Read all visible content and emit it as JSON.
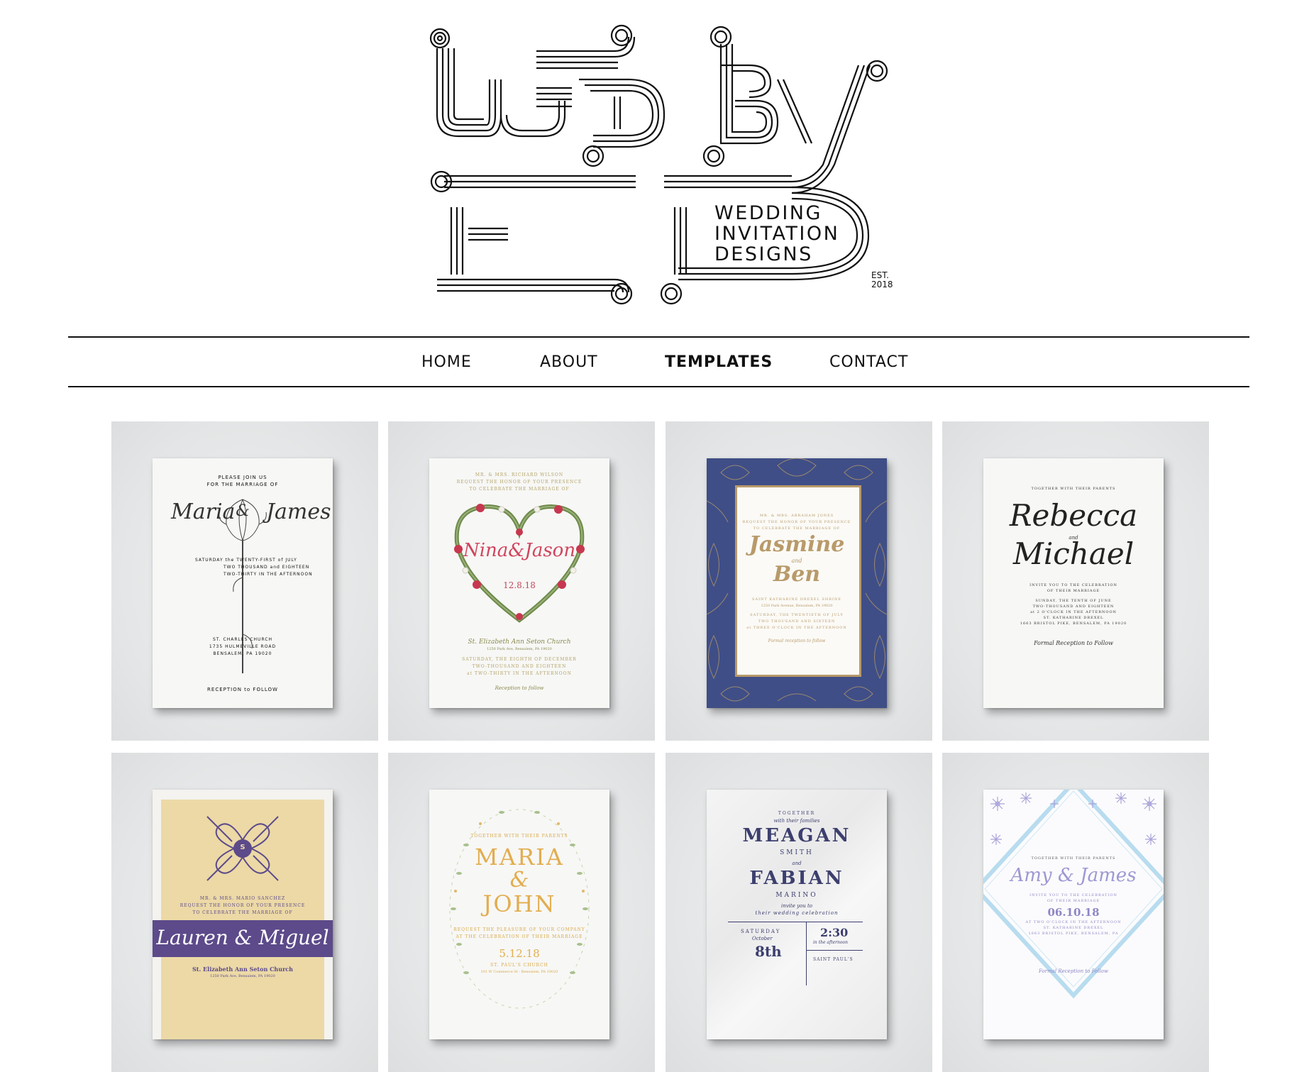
{
  "logo": {
    "sub_lines": [
      "WEDDING",
      "INVITATION",
      "DESIGNS"
    ],
    "est": [
      "EST.",
      "2018"
    ]
  },
  "nav": {
    "items": [
      {
        "label": "HOME"
      },
      {
        "label": "ABOUT"
      },
      {
        "label": "TEMPLATES",
        "active": true
      },
      {
        "label": "CONTACT"
      }
    ]
  },
  "templates": {
    "maria_james": {
      "top": "PLEASE JOIN US",
      "top2": "FOR THE MARRIAGE OF",
      "name1": "Maria",
      "amp": "&",
      "name2": "James",
      "date1": "SATURDAY the TWENTY-FIRST of JULY",
      "date2": "TWO THOUSAND and EIGHTEEN",
      "date3": "TWO-THIRTY IN THE AFTERNOON",
      "venue1": "ST. CHARLES CHURCH",
      "venue2": "1735 HULMEVILLE ROAD",
      "venue3": "BENSALEM, PA 19020",
      "reception": "RECEPTION to FOLLOW"
    },
    "nina_jason": {
      "top1": "MR. & MRS. RICHARD WILSON",
      "top2": "REQUEST THE HONOR OF YOUR PRESENCE",
      "top3": "TO CELEBRATE THE MARRIAGE OF",
      "names": "Nina&Jason",
      "date": "12.8.18",
      "venue": "St. Elizabeth Ann Seton Church",
      "address": "1250 Park Ave, Bensalem, PA 19020",
      "line1": "SATURDAY, THE EIGHTH OF DECEMBER",
      "line2": "TWO-THOUSAND AND EIGHTEEN",
      "line3": "at TWO-THIRTY IN THE AFTERNOON",
      "reception": "Reception to follow"
    },
    "jasmine_ben": {
      "top1": "MR. & MRS. ABRAHAM JONES",
      "top2": "REQUEST THE HONOR OF YOUR PRESENCE",
      "top3": "TO CELEBRATE THE MARRIAGE OF",
      "name1": "Jasmine",
      "and": "and",
      "name2": "Ben",
      "venue1": "SAINT KATHARINE DREXEL SHRINE",
      "venue2": "1250 Park Avenue, Bensalem, PA 19020",
      "line1": "SATURDAY, THE TWENTIETH OF JULY",
      "line2": "TWO THOUSAND AND SIXTEEN",
      "line3": "at THREE O'CLOCK IN THE AFTERNOON",
      "reception": "Formal reception to follow"
    },
    "rebecca_michael": {
      "top": "TOGETHER WITH THEIR PARENTS",
      "name1": "Rebecca",
      "and": "and",
      "name2": "Michael",
      "l1": "INVITE YOU TO THE CELEBRATION",
      "l2": "OF THEIR MARRIAGE",
      "l3": "SUNDAY, THE TENTH OF JUNE",
      "l4": "TWO-THOUSAND AND EIGHTEEN",
      "l5": "at 2 O'CLOCK IN THE AFTERNOON",
      "l6": "ST. KATHARINE DREXEL",
      "l7": "1663 BRISTOL PIKE, BENSALEM, PA 19020",
      "reception": "Formal Reception to Follow"
    },
    "lauren_miguel": {
      "monogram": "S",
      "top1": "MR. & MRS. MARIO SANCHEZ",
      "top2": "REQUEST THE HONOR OF YOUR PRESENCE",
      "top3": "TO CELEBRATE THE MARRIAGE OF",
      "names": "Lauren & Miguel",
      "venue": "St. Elizabeth Ann Seton Church",
      "address": "1250 Park Ave, Bensalem, PA 19020"
    },
    "maria_john": {
      "top": "TOGETHER WITH THEIR PARENTS",
      "name1": "MARIA",
      "amp": "&",
      "name2": "JOHN",
      "l1": "REQUEST THE PLEASURE OF YOUR COMPANY",
      "l2": "AT THE CELEBRATION OF THEIR MARRIAGE",
      "date": "5.12.18",
      "venue": "ST. PAUL'S CHURCH",
      "address": "101 W Commerce St · Bensalem, PA 19020"
    },
    "meagan_fabian": {
      "top": "TOGETHER",
      "top2": "with their families",
      "name1": "MEAGAN",
      "sur1": "SMITH",
      "and": "and",
      "name2": "FABIAN",
      "sur2": "MARINO",
      "invite1": "invite you to",
      "invite2": "their wedding celebration",
      "day": "SATURDAY",
      "month": "October",
      "date": "8th",
      "time": "2:30",
      "time2": "in the afternoon",
      "venue": "SAINT PAUL'S"
    },
    "amy_james": {
      "top": "TOGETHER WITH THEIR PARENTS",
      "names": "Amy & James",
      "l1": "INVITE YOU TO THE CELEBRATION",
      "l2": "OF THEIR MARRIAGE",
      "date": "06.10.18",
      "l3": "AT TWO O'CLOCK IN THE AFTERNOON",
      "l4": "ST. KATHARINE DREXEL",
      "l5": "1663 BRISTOL PIKE, BENSALEM, PA",
      "reception": "Formal Reception to Follow"
    }
  },
  "colors": {
    "nav_text": "#111111",
    "tile_bg": "#e5e6e7",
    "navy": "#3f4e86",
    "gold": "#b89a6a",
    "rose": "#d0455e",
    "purple": "#5c4a8a",
    "cream": "#ecd9a6",
    "lavender": "#8d86c4"
  }
}
